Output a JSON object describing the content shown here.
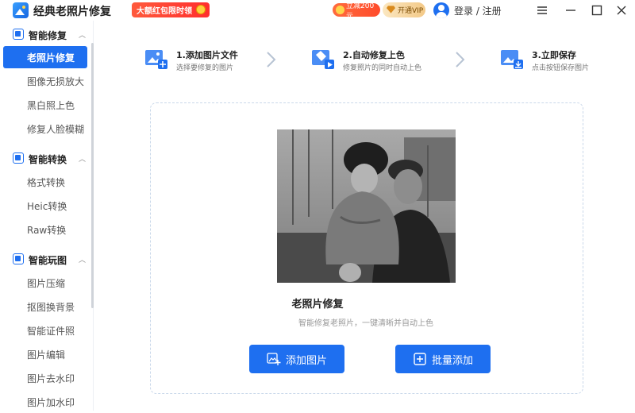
{
  "app": {
    "title": "经典老照片修复",
    "promo": "大额红包限时领",
    "discount": "立减200元",
    "vip": "开通VIP",
    "login": "登录 / 注册"
  },
  "sidebar": {
    "groups": [
      {
        "label": "智能修复",
        "items": [
          "老照片修复",
          "图像无损放大",
          "黑白照上色",
          "修复人脸模糊"
        ]
      },
      {
        "label": "智能转换",
        "items": [
          "格式转换",
          "Heic转换",
          "Raw转换"
        ]
      },
      {
        "label": "智能玩图",
        "items": [
          "图片压缩",
          "抠图换背景",
          "智能证件照",
          "图片编辑",
          "图片去水印",
          "图片加水印"
        ]
      }
    ],
    "active": "老照片修复"
  },
  "steps": [
    {
      "title": "1.添加图片文件",
      "desc": "选择要修复的图片"
    },
    {
      "title": "2.自动修复上色",
      "desc": "修复照片的同时自动上色"
    },
    {
      "title": "3.立即保存",
      "desc": "点击按钮保存图片"
    }
  ],
  "main": {
    "title": "老照片修复",
    "subtitle": "智能修复老照片，一键清晰并自动上色",
    "add_button": "添加图片",
    "batch_button": "批量添加"
  },
  "colors": {
    "accent": "#1e6ff0",
    "promo": "#ff3b2f"
  },
  "icons": [
    "image-add-icon",
    "paint-bucket-icon",
    "image-save-icon",
    "chevron-right-icon",
    "user-icon",
    "menu-icon",
    "minimize-icon",
    "maximize-icon",
    "close-icon",
    "plus-square-icon"
  ]
}
